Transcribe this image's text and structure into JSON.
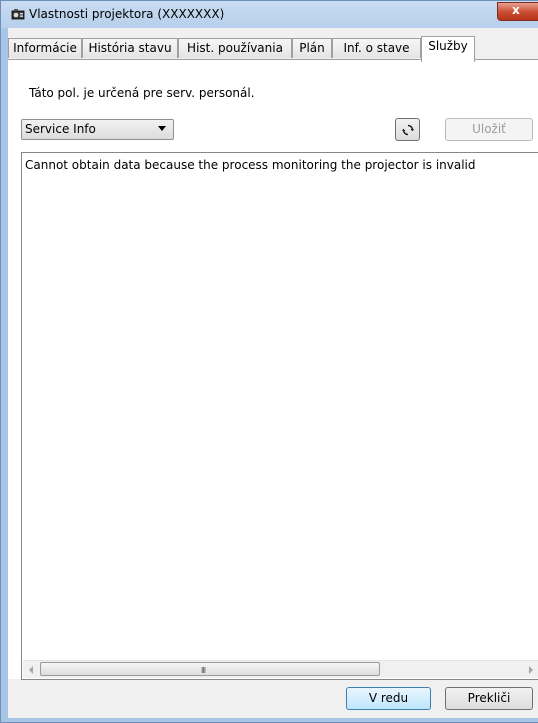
{
  "window": {
    "title": "Vlastnosti projektora (XXXXXXX)",
    "close_label": "x",
    "accent": "#c94b30"
  },
  "tabs": [
    {
      "label": "Informácie",
      "active": false
    },
    {
      "label": "História stavu",
      "active": false
    },
    {
      "label": "Hist. používania",
      "active": false
    },
    {
      "label": "Plán",
      "active": false
    },
    {
      "label": "Inf. o stave",
      "active": false
    },
    {
      "label": "Služby",
      "active": true
    }
  ],
  "service": {
    "notice": "Táto pol. je určená pre serv. personál.",
    "selector_value": "Service Info",
    "refresh_icon": "refresh-icon",
    "save_label": "Uložiť",
    "output_text": "Cannot obtain data because the process monitoring the projector is invalid"
  },
  "scrollbar": {
    "grip": "III"
  },
  "footer": {
    "ok_label": "V redu",
    "cancel_label": "Prekliči"
  }
}
